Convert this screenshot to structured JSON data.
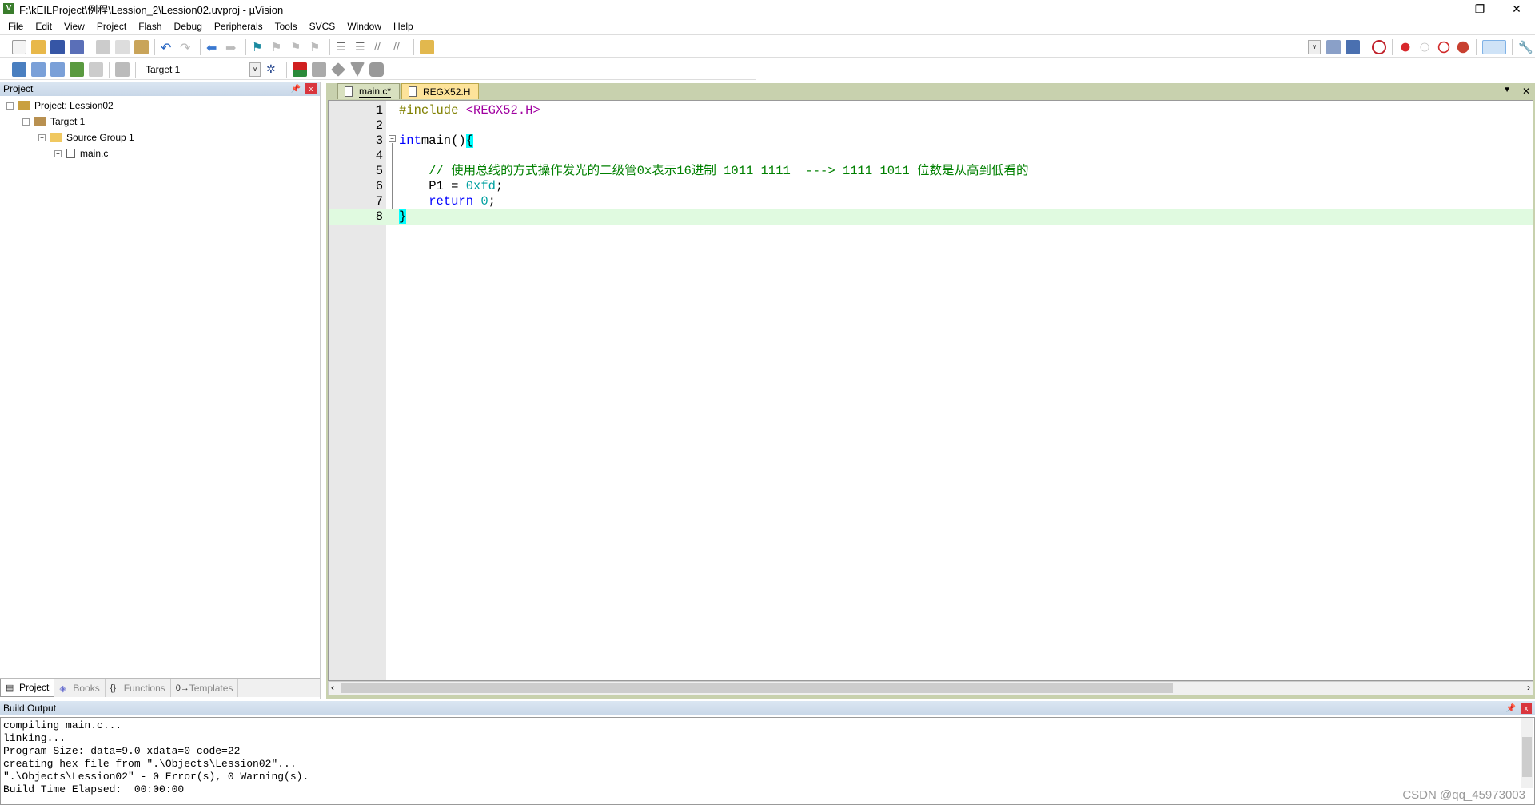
{
  "window": {
    "title": "F:\\kEILProject\\例程\\Lession_2\\Lession02.uvproj - µVision",
    "minimize": "—",
    "restore": "❐",
    "close": "✕"
  },
  "menu": [
    "File",
    "Edit",
    "View",
    "Project",
    "Flash",
    "Debug",
    "Peripherals",
    "Tools",
    "SVCS",
    "Window",
    "Help"
  ],
  "toolbar": {
    "target": "Target 1"
  },
  "project_panel": {
    "title": "Project",
    "tree": [
      "Project: Lession02",
      "Target 1",
      "Source Group 1",
      "main.c"
    ],
    "tabs": [
      "Project",
      "Books",
      "Functions",
      "Templates"
    ]
  },
  "editor": {
    "tabs": [
      "main.c*",
      "REGX52.H"
    ],
    "lines": [
      {
        "n": "1",
        "parts": [
          [
            "pp",
            "#include "
          ],
          [
            "inc",
            "<REGX52.H>"
          ]
        ]
      },
      {
        "n": "2",
        "parts": []
      },
      {
        "n": "3",
        "parts": [
          [
            "kw",
            "int"
          ],
          [
            "",
            "main()"
          ],
          [
            "br",
            "{"
          ]
        ]
      },
      {
        "n": "4",
        "parts": []
      },
      {
        "n": "5",
        "parts": [
          [
            "cm",
            "    // 使用总线的方式操作发光的二级管0x表示16进制 1011 1111  ---> 1111 1011 位数是从高到低看的"
          ]
        ]
      },
      {
        "n": "6",
        "parts": [
          [
            "",
            "    P1 = "
          ],
          [
            "num",
            "0xfd"
          ],
          [
            "",
            ";"
          ]
        ]
      },
      {
        "n": "7",
        "parts": [
          [
            "kw",
            "    return "
          ],
          [
            "num",
            "0"
          ],
          [
            "",
            ";"
          ]
        ]
      },
      {
        "n": "8",
        "parts": [
          [
            "br",
            "}"
          ]
        ]
      }
    ]
  },
  "build_output": {
    "title": "Build Output",
    "lines": [
      "compiling main.c...",
      "linking...",
      "Program Size: data=9.0 xdata=0 code=22",
      "creating hex file from \".\\Objects\\Lession02\"...",
      "\".\\Objects\\Lession02\" - 0 Error(s), 0 Warning(s).",
      "Build Time Elapsed:  00:00:00"
    ]
  },
  "watermark": "CSDN @qq_45973003"
}
